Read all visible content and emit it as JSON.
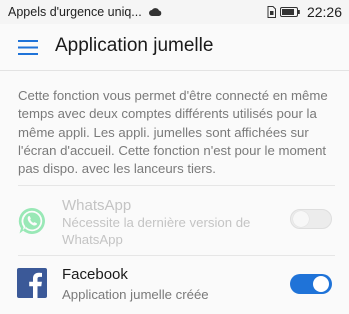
{
  "status_bar": {
    "carrier_text": "Appels d'urgence uniq...",
    "time": "22:26"
  },
  "header": {
    "title": "Application jumelle",
    "menu_icon": "hamburger-menu-icon"
  },
  "description": "Cette fonction vous permet d'être connecté en même temps avec deux comptes différents utilisés pour la même appli. Les appli. jumelles sont affichées sur l'écran d'accueil. Cette fonction n'est pour le moment pas dispo. avec les lanceurs tiers.",
  "apps": [
    {
      "name": "WhatsApp",
      "subtitle": "Nécessite la dernière version de WhatsApp",
      "icon": "whatsapp-icon",
      "enabled": false,
      "toggle_on": false
    },
    {
      "name": "Facebook",
      "subtitle": "Application jumelle créée",
      "icon": "facebook-icon",
      "enabled": true,
      "toggle_on": true
    }
  ],
  "colors": {
    "accent": "#1f73d8",
    "whatsapp_green": "#25d366",
    "facebook_blue": "#3b5998"
  }
}
